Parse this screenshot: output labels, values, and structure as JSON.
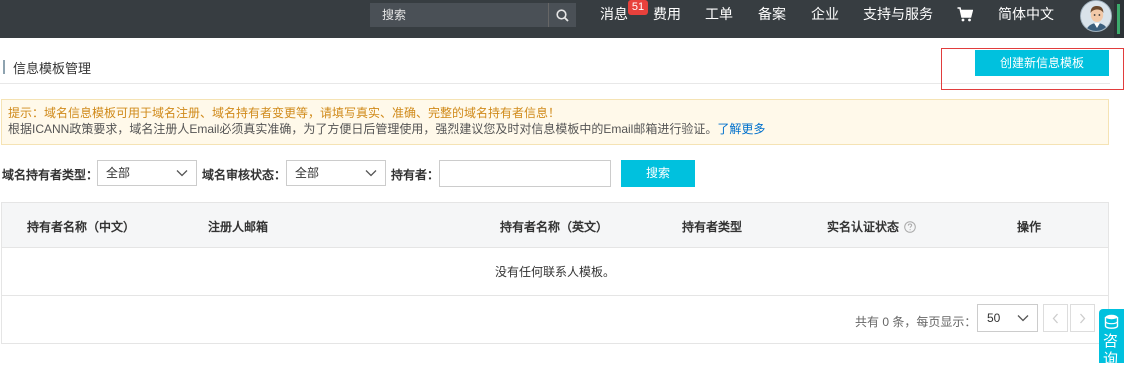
{
  "topbar": {
    "search_placeholder": "搜索",
    "nav": {
      "messages": "消息",
      "messages_badge": "51",
      "fees": "费用",
      "tickets": "工单",
      "filing": "备案",
      "enterprise": "企业",
      "support": "支持与服务",
      "language": "简体中文"
    }
  },
  "header": {
    "title": "信息模板管理",
    "create_button": "创建新信息模板"
  },
  "notice": {
    "line1": "提示：域名信息模板可用于域名注册、域名持有者变更等，请填写真实、准确、完整的域名持有者信息！",
    "line2": "根据ICANN政策要求，域名注册人Email必须真实准确，为了方便日后管理使用，强烈建议您及时对信息模板中的Email邮箱进行验证。",
    "learn_more": "了解更多"
  },
  "filters": {
    "holder_type_label": "域名持有者类型：",
    "holder_type_value": "全部",
    "audit_status_label": "域名审核状态：",
    "audit_status_value": "全部",
    "holder_label": "持有者：",
    "holder_value": "",
    "search_button": "搜索"
  },
  "table": {
    "columns": [
      "持有者名称（中文）",
      "注册人邮箱",
      "持有者名称（英文）",
      "持有者类型",
      "实名认证状态",
      "操作"
    ],
    "empty_text": "没有任何联系人模板。"
  },
  "pager": {
    "summary": "共有 0 条，每页显示：",
    "page_size": "50"
  },
  "consult": {
    "label": "咨询"
  }
}
